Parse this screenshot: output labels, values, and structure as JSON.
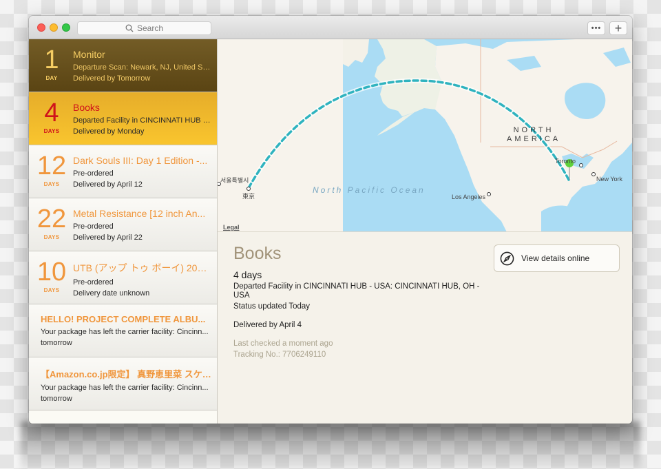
{
  "titlebar": {
    "search_placeholder": "Search",
    "more_label": "•••",
    "add_label": "+"
  },
  "deliveries": [
    {
      "count": "1",
      "unit": "DAY",
      "title": "Monitor",
      "line1": "Departure Scan: Newark, NJ, United St...",
      "line2": "Delivered by Tomorrow",
      "state": "dark"
    },
    {
      "count": "4",
      "unit": "DAYS",
      "title": "Books",
      "line1": "Departed Facility in CINCINNATI HUB -...",
      "line2": "Delivered by Monday",
      "state": "selected"
    },
    {
      "count": "12",
      "unit": "DAYS",
      "title": "Dark Souls III: Day 1 Edition -...",
      "line1": "Pre-ordered",
      "line2": "Delivered by April 12",
      "state": "normal"
    },
    {
      "count": "22",
      "unit": "DAYS",
      "title": "Metal Resistance [12 inch An...",
      "line1": "Pre-ordered",
      "line2": "Delivered by April 22",
      "state": "normal"
    },
    {
      "count": "10",
      "unit": "DAYS",
      "title": "UTB (アップ トゥ ボーイ) 2016…",
      "line1": "Pre-ordered",
      "line2": "Delivery date unknown",
      "state": "normal"
    },
    {
      "count": "",
      "unit": "",
      "title": "HELLO! PROJECT COMPLETE ALBU...",
      "line1": "Your package has left the carrier facility: Cincinn...",
      "line2": "tomorrow",
      "state": "noday"
    },
    {
      "count": "",
      "unit": "",
      "title": "【Amazon.co.jp限定】 真野恵里菜 スケ…",
      "line1": "Your package has left the carrier facility: Cincinn...",
      "line2": "tomorrow",
      "state": "noday"
    }
  ],
  "map": {
    "labels": {
      "seoul": "서울특별시",
      "tokyo": "東京",
      "toronto": "Toronto",
      "new_york": "New York",
      "los_angeles": "Los Angeles",
      "ocean": "North Pacific Ocean",
      "continent_line1": "NORTH",
      "continent_line2": "AMERICA",
      "legal": "Legal"
    },
    "route_color": "#2fb3bf",
    "pin_color": "#5fd13a"
  },
  "detail": {
    "title": "Books",
    "days": "4 days",
    "status": "Departed Facility in CINCINNATI HUB - USA: CINCINNATI HUB, OH - USA",
    "updated": "Status updated Today",
    "delivered": "Delivered by April 4",
    "last_checked": "Last checked a moment ago",
    "tracking": "Tracking No.: 7706249110",
    "view_button": "View details online"
  }
}
